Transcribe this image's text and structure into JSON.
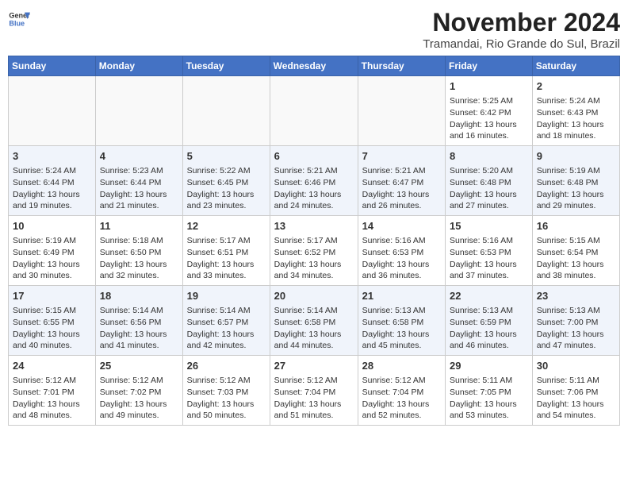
{
  "header": {
    "logo_line1": "General",
    "logo_line2": "Blue",
    "title": "November 2024",
    "subtitle": "Tramandai, Rio Grande do Sul, Brazil"
  },
  "days_of_week": [
    "Sunday",
    "Monday",
    "Tuesday",
    "Wednesday",
    "Thursday",
    "Friday",
    "Saturday"
  ],
  "weeks": [
    [
      {
        "day": "",
        "info": ""
      },
      {
        "day": "",
        "info": ""
      },
      {
        "day": "",
        "info": ""
      },
      {
        "day": "",
        "info": ""
      },
      {
        "day": "",
        "info": ""
      },
      {
        "day": "1",
        "info": "Sunrise: 5:25 AM\nSunset: 6:42 PM\nDaylight: 13 hours\nand 16 minutes."
      },
      {
        "day": "2",
        "info": "Sunrise: 5:24 AM\nSunset: 6:43 PM\nDaylight: 13 hours\nand 18 minutes."
      }
    ],
    [
      {
        "day": "3",
        "info": "Sunrise: 5:24 AM\nSunset: 6:44 PM\nDaylight: 13 hours\nand 19 minutes."
      },
      {
        "day": "4",
        "info": "Sunrise: 5:23 AM\nSunset: 6:44 PM\nDaylight: 13 hours\nand 21 minutes."
      },
      {
        "day": "5",
        "info": "Sunrise: 5:22 AM\nSunset: 6:45 PM\nDaylight: 13 hours\nand 23 minutes."
      },
      {
        "day": "6",
        "info": "Sunrise: 5:21 AM\nSunset: 6:46 PM\nDaylight: 13 hours\nand 24 minutes."
      },
      {
        "day": "7",
        "info": "Sunrise: 5:21 AM\nSunset: 6:47 PM\nDaylight: 13 hours\nand 26 minutes."
      },
      {
        "day": "8",
        "info": "Sunrise: 5:20 AM\nSunset: 6:48 PM\nDaylight: 13 hours\nand 27 minutes."
      },
      {
        "day": "9",
        "info": "Sunrise: 5:19 AM\nSunset: 6:48 PM\nDaylight: 13 hours\nand 29 minutes."
      }
    ],
    [
      {
        "day": "10",
        "info": "Sunrise: 5:19 AM\nSunset: 6:49 PM\nDaylight: 13 hours\nand 30 minutes."
      },
      {
        "day": "11",
        "info": "Sunrise: 5:18 AM\nSunset: 6:50 PM\nDaylight: 13 hours\nand 32 minutes."
      },
      {
        "day": "12",
        "info": "Sunrise: 5:17 AM\nSunset: 6:51 PM\nDaylight: 13 hours\nand 33 minutes."
      },
      {
        "day": "13",
        "info": "Sunrise: 5:17 AM\nSunset: 6:52 PM\nDaylight: 13 hours\nand 34 minutes."
      },
      {
        "day": "14",
        "info": "Sunrise: 5:16 AM\nSunset: 6:53 PM\nDaylight: 13 hours\nand 36 minutes."
      },
      {
        "day": "15",
        "info": "Sunrise: 5:16 AM\nSunset: 6:53 PM\nDaylight: 13 hours\nand 37 minutes."
      },
      {
        "day": "16",
        "info": "Sunrise: 5:15 AM\nSunset: 6:54 PM\nDaylight: 13 hours\nand 38 minutes."
      }
    ],
    [
      {
        "day": "17",
        "info": "Sunrise: 5:15 AM\nSunset: 6:55 PM\nDaylight: 13 hours\nand 40 minutes."
      },
      {
        "day": "18",
        "info": "Sunrise: 5:14 AM\nSunset: 6:56 PM\nDaylight: 13 hours\nand 41 minutes."
      },
      {
        "day": "19",
        "info": "Sunrise: 5:14 AM\nSunset: 6:57 PM\nDaylight: 13 hours\nand 42 minutes."
      },
      {
        "day": "20",
        "info": "Sunrise: 5:14 AM\nSunset: 6:58 PM\nDaylight: 13 hours\nand 44 minutes."
      },
      {
        "day": "21",
        "info": "Sunrise: 5:13 AM\nSunset: 6:58 PM\nDaylight: 13 hours\nand 45 minutes."
      },
      {
        "day": "22",
        "info": "Sunrise: 5:13 AM\nSunset: 6:59 PM\nDaylight: 13 hours\nand 46 minutes."
      },
      {
        "day": "23",
        "info": "Sunrise: 5:13 AM\nSunset: 7:00 PM\nDaylight: 13 hours\nand 47 minutes."
      }
    ],
    [
      {
        "day": "24",
        "info": "Sunrise: 5:12 AM\nSunset: 7:01 PM\nDaylight: 13 hours\nand 48 minutes."
      },
      {
        "day": "25",
        "info": "Sunrise: 5:12 AM\nSunset: 7:02 PM\nDaylight: 13 hours\nand 49 minutes."
      },
      {
        "day": "26",
        "info": "Sunrise: 5:12 AM\nSunset: 7:03 PM\nDaylight: 13 hours\nand 50 minutes."
      },
      {
        "day": "27",
        "info": "Sunrise: 5:12 AM\nSunset: 7:04 PM\nDaylight: 13 hours\nand 51 minutes."
      },
      {
        "day": "28",
        "info": "Sunrise: 5:12 AM\nSunset: 7:04 PM\nDaylight: 13 hours\nand 52 minutes."
      },
      {
        "day": "29",
        "info": "Sunrise: 5:11 AM\nSunset: 7:05 PM\nDaylight: 13 hours\nand 53 minutes."
      },
      {
        "day": "30",
        "info": "Sunrise: 5:11 AM\nSunset: 7:06 PM\nDaylight: 13 hours\nand 54 minutes."
      }
    ]
  ]
}
